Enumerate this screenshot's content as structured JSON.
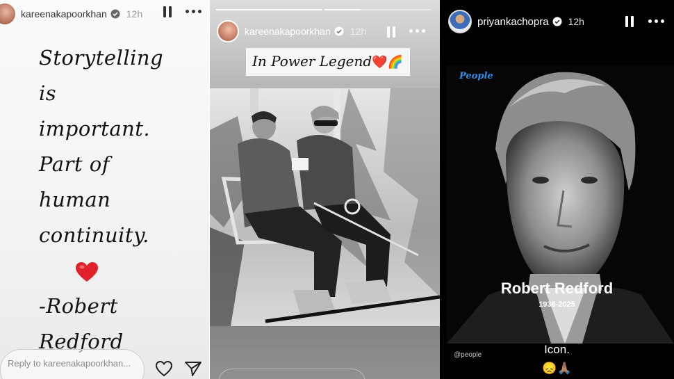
{
  "story1": {
    "username": "kareenakapoorkhan",
    "time": "12h",
    "lines": [
      "Storytelling",
      "is",
      "important.",
      "Part of",
      "human",
      "continuity."
    ],
    "signature": [
      "-Robert",
      "Redford"
    ],
    "reply_placeholder": "Reply to kareenakapoorkhan...",
    "heart_icon": "heart-emoji",
    "colors": {
      "heart": "#e0202a"
    }
  },
  "story2": {
    "username": "kareenakapoorkhan",
    "time": "12h",
    "caption": "In Power Legend",
    "caption_emojis": "❤️🌈",
    "progress": [
      1.0,
      0.33
    ]
  },
  "story3": {
    "username": "priyankachopra",
    "time": "12h",
    "brand": "People",
    "name": "Robert Redford",
    "years": "1936-2025",
    "handle": "@people",
    "text": "Icon.",
    "emojis": "😞🙏🏽",
    "colors": {
      "brand": "#2f8fe8"
    }
  }
}
